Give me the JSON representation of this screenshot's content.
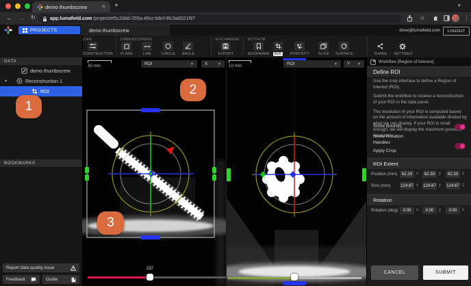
{
  "browser": {
    "tab_title": "demo thumbscrew",
    "url_domain": "app.lumafield.com",
    "url_path": "/project/ef5c2ddd-255a-46cc-b8cf-8fc3a0021f97"
  },
  "header": {
    "projects_label": "PROJECTS",
    "project_title": "demo thumbscrew",
    "user_email": "drew@lumafield.com",
    "logout_label": "LOGOUT"
  },
  "toolbar": {
    "sections": [
      {
        "label": "SCAN",
        "tools": [
          {
            "label": "RECONSTRUCTION"
          }
        ]
      },
      {
        "label": "DIMENSIONING",
        "tools": [
          {
            "label": "PLANE"
          },
          {
            "label": "LINE"
          },
          {
            "label": "CIRCLE"
          },
          {
            "label": "ANGLE"
          }
        ]
      },
      {
        "label": "EXCHANGE",
        "tools": [
          {
            "label": "EXPORT"
          }
        ]
      },
      {
        "label": "AUTHOR",
        "tools": [
          {
            "label": "BOOKMARK"
          },
          {
            "label": "ROI",
            "active": true
          },
          {
            "label": "POROSITY"
          },
          {
            "label": "SLICE"
          },
          {
            "label": "SURFACE"
          }
        ]
      }
    ],
    "right_tools": [
      {
        "label": "SHARE"
      },
      {
        "label": "SETTINGS"
      }
    ]
  },
  "sidebar": {
    "data_header": "DATA",
    "items": [
      {
        "label": "demo thumbscrew",
        "selected": false
      },
      {
        "label": "Reconstruction 1",
        "selected": false
      },
      {
        "label": "ROI",
        "selected": true
      }
    ],
    "bookmarks_header": "BOOKMARKS",
    "report_button": "Report data quality issue",
    "feedback_button": "Feedback",
    "guide_button": "Guide"
  },
  "viewports": {
    "left": {
      "scale": "30 mm",
      "dataset_dropdown": "ROI",
      "axis_dropdown": "X",
      "slider_value": "237"
    },
    "right": {
      "scale": "10 mm",
      "dataset_dropdown": "ROI",
      "axis_dropdown": "Y"
    }
  },
  "workflow": {
    "panel_title": "Workflow [Region of Interest]",
    "define_roi": {
      "header": "Define ROI",
      "paragraphs": [
        "Use the crop interface to define a Region of Interest (ROI).",
        "Submit the workflow to receive a reconstruction of your ROI in the data panel.",
        "The resolution of your ROI is computed based on the amount of information available divided by what we can display. If your ROI is small enough, we will display the maximum possible resolution."
      ]
    },
    "toggles": [
      {
        "label": "Show Bounds",
        "on": true
      },
      {
        "label": "Show Rotation Handles",
        "on": true
      },
      {
        "label": "Apply Crop",
        "on": true
      }
    ],
    "roi_extent": {
      "header": "ROI Extent",
      "position_label": "Position (mm)",
      "position_values": [
        "62.33",
        "62.33",
        "62.33"
      ],
      "size_label": "Size (mm)",
      "size_values": [
        "124.67",
        "124.67",
        "124.67"
      ],
      "axes": [
        "x",
        "y",
        "z"
      ]
    },
    "rotation": {
      "header": "Rotation",
      "label": "Rotation (deg)",
      "values": [
        "0.00",
        "0.00",
        "0.00"
      ]
    },
    "cancel_label": "CANCEL",
    "submit_label": "SUBMIT"
  },
  "badges": [
    "1",
    "2",
    "3"
  ],
  "colors": {
    "accent_blue": "#2E62E6",
    "toggle_pink": "#D6246B",
    "badge_orange": "#D96B3F",
    "slider_red": "#E0174B",
    "handle_green": "#2FD32A",
    "handle_blue": "#2633F0"
  }
}
